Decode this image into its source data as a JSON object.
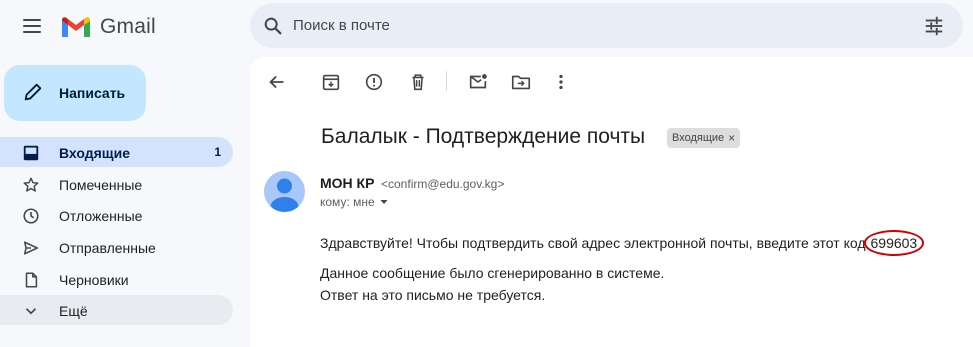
{
  "app": {
    "name": "Gmail"
  },
  "search": {
    "placeholder": "Поиск в почте"
  },
  "compose": {
    "label": "Написать"
  },
  "sidebar": {
    "items": [
      {
        "label": "Входящие",
        "count": "1",
        "icon": "inbox-icon"
      },
      {
        "label": "Помеченные",
        "icon": "star-icon"
      },
      {
        "label": "Отложенные",
        "icon": "clock-icon"
      },
      {
        "label": "Отправленные",
        "icon": "send-icon"
      },
      {
        "label": "Черновики",
        "icon": "draft-icon"
      },
      {
        "label": "Ещё",
        "icon": "chevron-down-icon"
      }
    ]
  },
  "toolbar": {
    "icons": [
      "back-arrow-icon",
      "archive-icon",
      "report-spam-icon",
      "delete-icon",
      "mark-unread-icon",
      "move-to-icon",
      "more-vert-icon"
    ]
  },
  "email": {
    "subject": "Балалык - Подтверждение почты",
    "label_chip": "Входящие",
    "label_close": "×",
    "sender_name": "МОН КР",
    "sender_email": "<confirm@edu.gov.kg>",
    "recipient": "кому: мне",
    "body_line1": "Здравствуйте! Чтобы подтвердить свой адрес электронной почты, введите этот код",
    "code": "699603",
    "body_line2": "Данное сообщение было сгенерированно в системе.",
    "body_line3": "Ответ на это письмо не требуется."
  },
  "colors": {
    "accent_compose": "#c2e7ff",
    "active_nav": "#d3e3fd",
    "annotation_ring": "#d00000"
  }
}
